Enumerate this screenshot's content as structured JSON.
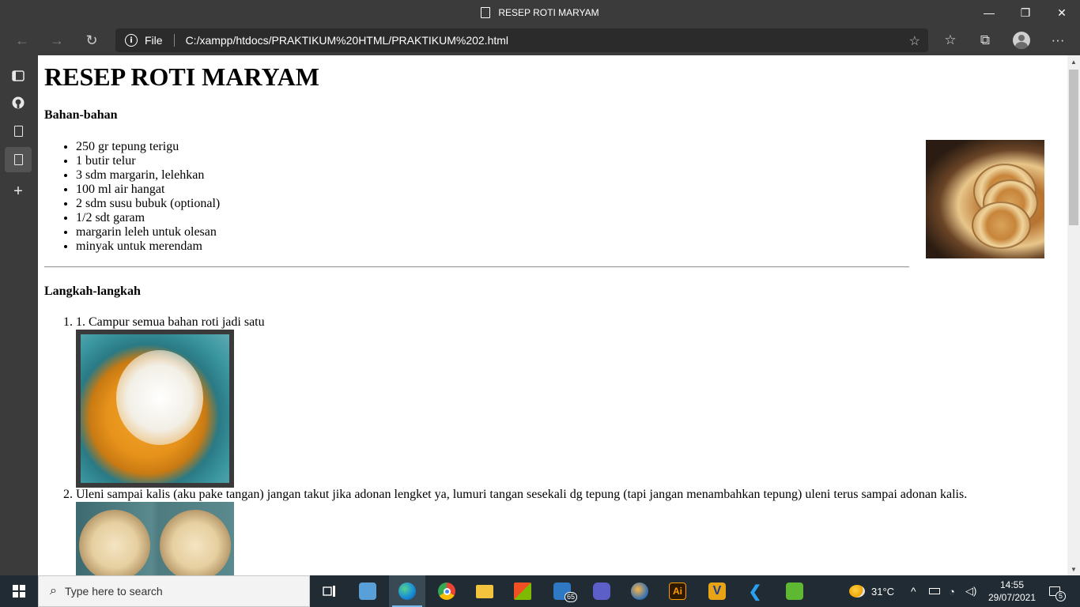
{
  "window": {
    "title": "RESEP ROTI MARYAM",
    "minimize": "—",
    "restore": "❐",
    "close": "✕"
  },
  "nav": {
    "back": "←",
    "forward": "→",
    "refresh": "↻",
    "address": {
      "info_glyph": "i",
      "file_label": "File",
      "url": "C:/xampp/htdocs/PRAKTIKUM%20HTML/PRAKTIKUM%202.html",
      "favorite_glyph": "☆"
    },
    "favorites_glyph": "☆",
    "collections_glyph": "⧉",
    "menu_glyph": "···"
  },
  "sidebar": {
    "add_glyph": "+"
  },
  "page": {
    "heading": "RESEP ROTI MARYAM",
    "ingredients_heading": "Bahan-bahan",
    "ingredients": [
      "250 gr tepung terigu",
      "1 butir telur",
      "3 sdm margarin, lelehkan",
      "100 ml air hangat",
      "2 sdm susu bubuk (optional)",
      "1/2 sdt garam",
      "margarin leleh untuk olesan",
      "minyak untuk merendam"
    ],
    "steps_heading": "Langkah-langkah",
    "steps": [
      "1. Campur semua bahan roti jadi satu",
      "Uleni sampai kalis (aku pake tangan) jangan takut jika adonan lengket ya, lumuri tangan sesekali dg tepung (tapi jangan menambahkan tepung) uleni terus sampai adonan kalis."
    ]
  },
  "scrollbar": {
    "up": "▲",
    "down": "▼"
  },
  "taskbar": {
    "search_placeholder": "Type here to search",
    "mail_badge": "65",
    "illustrator_label": "Ai",
    "v_label": "V",
    "weather": "31°C",
    "time": "14:55",
    "date": "29/07/2021",
    "notifications": "5"
  }
}
